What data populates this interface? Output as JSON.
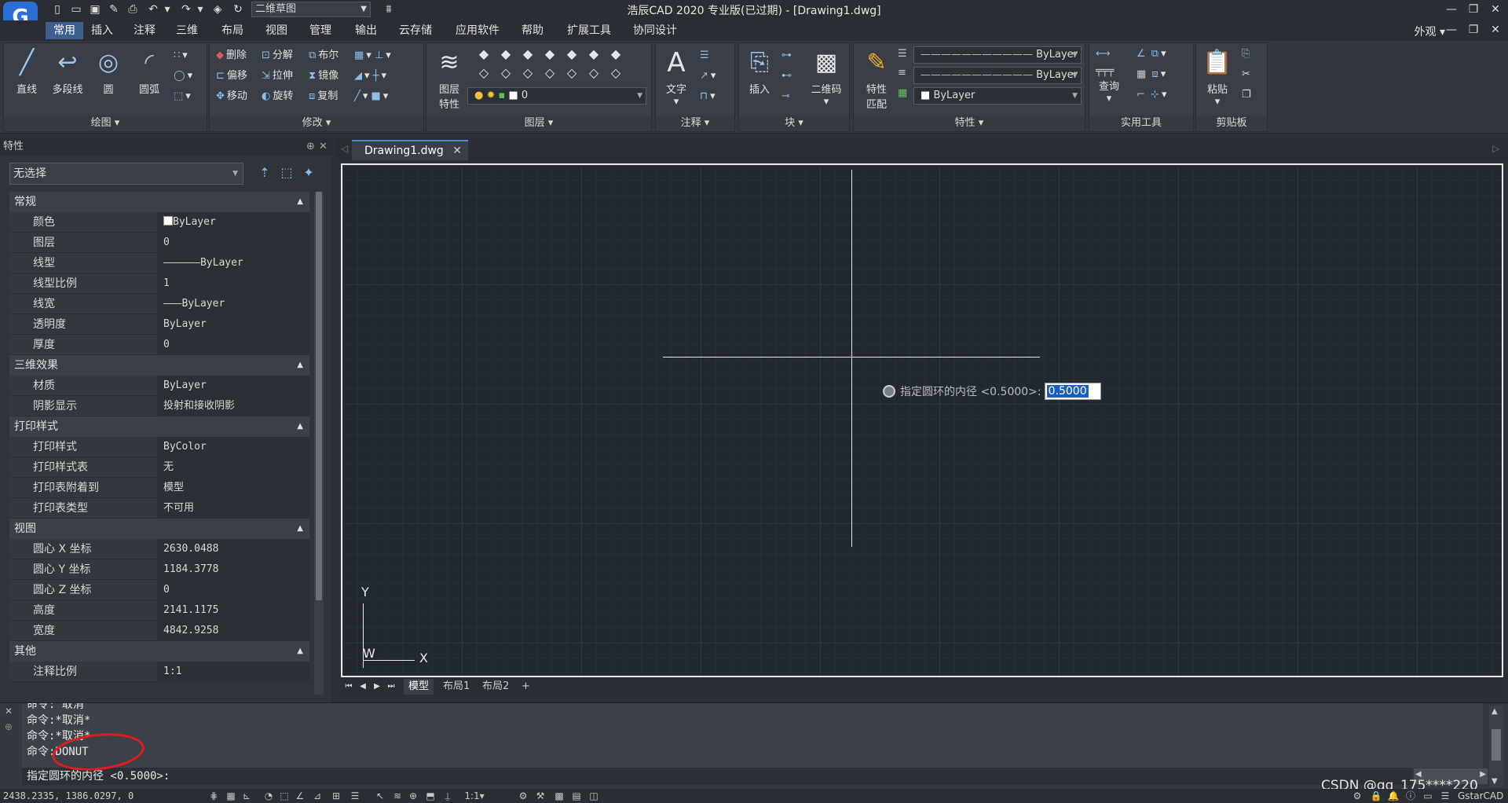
{
  "app": {
    "title": "浩辰CAD 2020 专业版(已过期) - [Drawing1.dwg]",
    "logo_letter": "G",
    "workspace": "二维草图",
    "appearance_label": "外观"
  },
  "menu_tabs": [
    "常用",
    "插入",
    "注释",
    "三维",
    "布局",
    "视图",
    "管理",
    "输出",
    "云存储",
    "应用软件",
    "帮助",
    "扩展工具",
    "协同设计"
  ],
  "ribbon": {
    "draw": {
      "title": "绘图",
      "line": "直线",
      "polyline": "多段线",
      "circle": "圆",
      "arc": "圆弧"
    },
    "modify": {
      "title": "修改",
      "delete": "删除",
      "explode": "分解",
      "boolean": "布尔",
      "offset": "偏移",
      "stretch": "拉伸",
      "mirror": "镜像",
      "move": "移动",
      "rotate": "旋转",
      "copy": "复制"
    },
    "layer": {
      "title": "图层",
      "layer_props": "图层\n特性",
      "layer_props_line1": "图层",
      "layer_props_line2": "特性",
      "current_layer": "0"
    },
    "annotation": {
      "title": "注释",
      "text": "文字"
    },
    "block": {
      "title": "块",
      "insert": "插入",
      "qrcode": "二维码"
    },
    "properties": {
      "title": "特性",
      "match_line1": "特性",
      "match_line2": "匹配",
      "linetype_combo": "ByLayer",
      "lineweight_combo": "ByLayer",
      "color_combo": "ByLayer"
    },
    "utilities": {
      "title": "实用工具",
      "query": "查询"
    },
    "clipboard": {
      "title": "剪贴板",
      "paste": "粘贴"
    }
  },
  "properties_panel": {
    "header": "特性",
    "selection": "无选择",
    "sections": [
      {
        "title": "常规",
        "rows": [
          {
            "k": "颜色",
            "v": "ByLayer"
          },
          {
            "k": "图层",
            "v": "0"
          },
          {
            "k": "线型",
            "v": "——————ByLayer"
          },
          {
            "k": "线型比例",
            "v": "1"
          },
          {
            "k": "线宽",
            "v": "———ByLayer"
          },
          {
            "k": "透明度",
            "v": "ByLayer"
          },
          {
            "k": "厚度",
            "v": "0"
          }
        ]
      },
      {
        "title": "三维效果",
        "rows": [
          {
            "k": "材质",
            "v": "ByLayer"
          },
          {
            "k": "阴影显示",
            "v": "投射和接收阴影"
          }
        ]
      },
      {
        "title": "打印样式",
        "rows": [
          {
            "k": "打印样式",
            "v": "ByColor"
          },
          {
            "k": "打印样式表",
            "v": "无"
          },
          {
            "k": "打印表附着到",
            "v": "模型"
          },
          {
            "k": "打印表类型",
            "v": "不可用"
          }
        ]
      },
      {
        "title": "视图",
        "rows": [
          {
            "k": "圆心 X 坐标",
            "v": "2630.0488"
          },
          {
            "k": "圆心 Y 坐标",
            "v": "1184.3778"
          },
          {
            "k": "圆心 Z 坐标",
            "v": "0"
          },
          {
            "k": "高度",
            "v": "2141.1175"
          },
          {
            "k": "宽度",
            "v": "4842.9258"
          }
        ]
      },
      {
        "title": "其他",
        "rows": [
          {
            "k": "注释比例",
            "v": "1:1"
          }
        ]
      }
    ]
  },
  "document": {
    "tab": "Drawing1.dwg",
    "prompt_label": "指定圆环的内径 <0.5000>:",
    "prompt_value": "0.5000",
    "ucs_y": "Y",
    "ucs_x": "X",
    "ucs_w": "W"
  },
  "layout_tabs": [
    "模型",
    "布局1",
    "布局2",
    "+"
  ],
  "command": {
    "history": [
      "命令: 取消",
      "命令:*取消*",
      "命令:*取消*",
      "命令:DONUT"
    ],
    "current": "指定圆环的内径 <0.5000>:"
  },
  "status": {
    "coords": "2438.2335, 1386.0297, 0",
    "brand": "GstarCAD"
  },
  "watermark": "CSDN @qq_175****220",
  "colors": {
    "accent": "#3e5f8e",
    "canvas_bg": "#212830",
    "annotation_circle": "#e21d1d"
  }
}
